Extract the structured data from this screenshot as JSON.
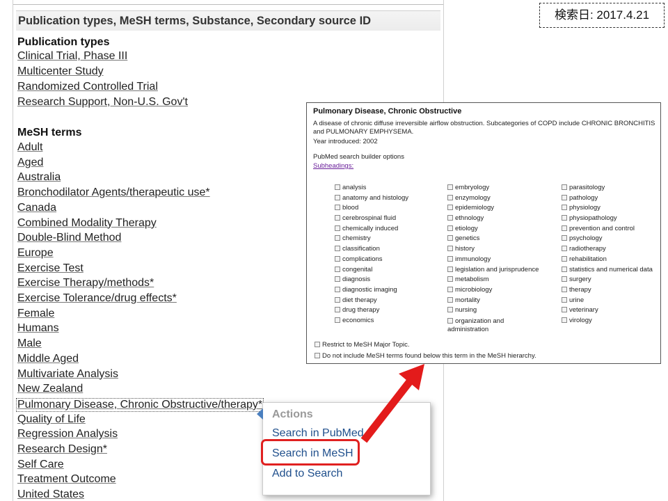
{
  "date_stamp": "検索日: 2017.4.21",
  "panel": {
    "header": "Publication types, MeSH terms, Substance, Secondary source ID",
    "publication_types_title": "Publication types",
    "publication_types": [
      "Clinical Trial, Phase III",
      "Multicenter Study",
      "Randomized Controlled Trial",
      "Research Support, Non-U.S. Gov't"
    ],
    "mesh_terms_title": "MeSH terms",
    "mesh_terms": [
      "Adult",
      "Aged",
      "Australia",
      "Bronchodilator Agents/therapeutic use*",
      "Canada",
      "Combined Modality Therapy",
      "Double-Blind Method",
      "Europe",
      "Exercise Test",
      "Exercise Therapy/methods*",
      "Exercise Tolerance/drug effects*",
      "Female",
      "Humans",
      "Male",
      "Middle Aged",
      "Multivariate Analysis",
      "New Zealand",
      "Pulmonary Disease, Chronic Obstructive/therapy*",
      "Quality of Life",
      "Regression Analysis",
      "Research Design*",
      "Self Care",
      "Treatment Outcome",
      "United States"
    ]
  },
  "actions_popup": {
    "title": "Actions",
    "items": [
      "Search in PubMed",
      "Search in MeSH",
      "Add to Search"
    ]
  },
  "mesh_detail": {
    "title": "Pulmonary Disease, Chronic Obstructive",
    "description": "A disease of chronic diffuse irreversible airflow obstruction. Subcategories of COPD include CHRONIC BRONCHITIS and PULMONARY EMPHYSEMA.",
    "year": "Year introduced: 2002",
    "builder_label": "PubMed search builder options",
    "subheadings_link": "Subheadings:",
    "col1": [
      "analysis",
      "anatomy and histology",
      "blood",
      "cerebrospinal fluid",
      "chemically induced",
      "chemistry",
      "classification",
      "complications",
      "congenital",
      "diagnosis",
      "diagnostic imaging",
      "diet therapy",
      "drug therapy",
      "economics"
    ],
    "col2": [
      "embryology",
      "enzymology",
      "epidemiology",
      "ethnology",
      "etiology",
      "genetics",
      "history",
      "immunology",
      "legislation and jurisprudence",
      "metabolism",
      "microbiology",
      "mortality",
      "nursing",
      "organization and administration"
    ],
    "col3": [
      "parasitology",
      "pathology",
      "physiology",
      "physiopathology",
      "prevention and control",
      "psychology",
      "radiotherapy",
      "rehabilitation",
      "statistics and numerical data",
      "surgery",
      "therapy",
      "urine",
      "veterinary",
      "virology"
    ],
    "restrict_major": "Restrict to MeSH Major Topic.",
    "no_explode": "Do not include MeSH terms found below this term in the MeSH hierarchy."
  }
}
